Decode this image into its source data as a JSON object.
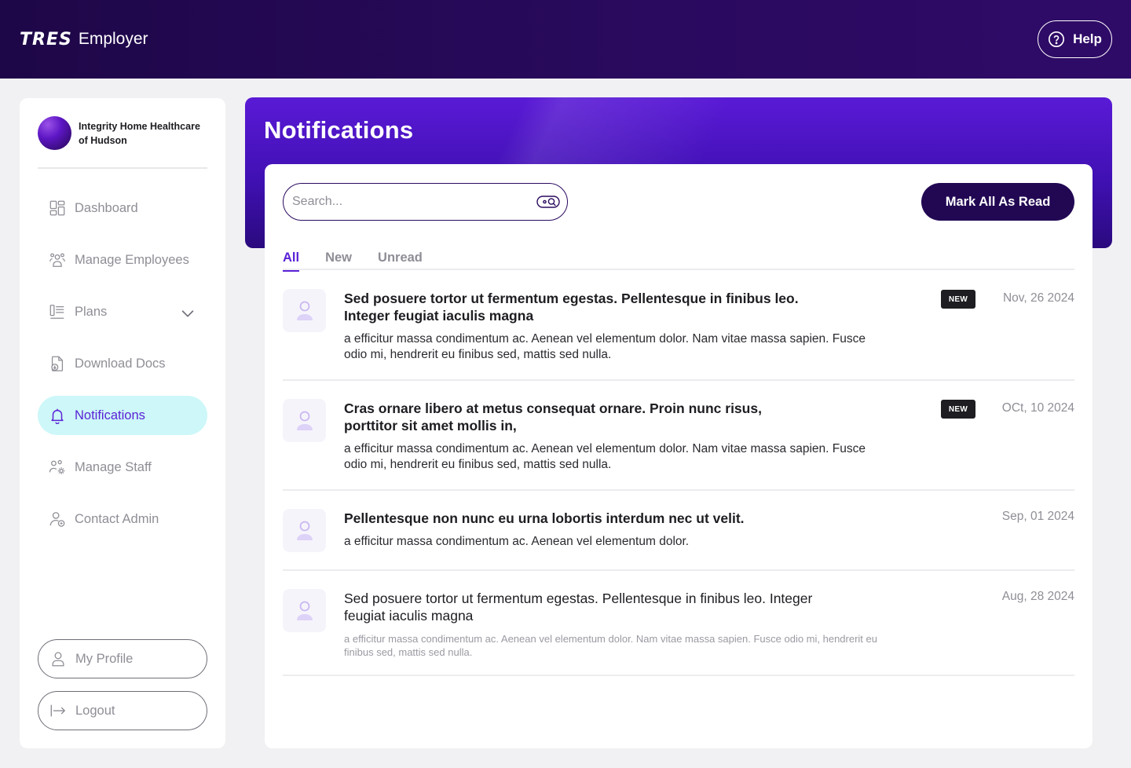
{
  "app": {
    "brand_logo": "TRES",
    "brand_name": "Employer",
    "help_label": "Help"
  },
  "sidebar": {
    "org_name": "Integrity Home Healthcare of Hudson",
    "items": [
      {
        "label": "Dashboard",
        "icon": "dashboard-icon"
      },
      {
        "label": "Manage Employees",
        "icon": "employees-icon"
      },
      {
        "label": "Plans",
        "icon": "plans-icon"
      },
      {
        "label": "Download Docs",
        "icon": "download-doc-icon"
      },
      {
        "label": "Notifications",
        "icon": "bell-icon",
        "active": true
      },
      {
        "label": "Manage Staff",
        "icon": "staff-gear-icon"
      },
      {
        "label": "Contact Admin",
        "icon": "contact-admin-icon"
      }
    ],
    "profile_label": "My Profile",
    "logout_label": "Logout"
  },
  "main": {
    "title": "Notifications",
    "search_placeholder": "Search...",
    "mark_all_label": "Mark All As Read",
    "tabs": [
      {
        "label": "All",
        "active": true
      },
      {
        "label": "New"
      },
      {
        "label": "Unread"
      }
    ],
    "notifications": [
      {
        "title": "Sed posuere tortor ut fermentum egestas. Pellentesque in finibus leo. Integer feugiat iaculis magna",
        "body": "a efficitur massa condimentum ac. Aenean vel elementum dolor. Nam vitae massa sapien. Fusce odio mi, hendrerit eu finibus sed, mattis sed nulla.",
        "badge": "NEW",
        "date": "Nov, 26 2024"
      },
      {
        "title": "Cras ornare libero at metus consequat ornare. Proin nunc risus, porttitor sit amet mollis in,",
        "body": "a efficitur massa condimentum ac. Aenean vel elementum dolor. Nam vitae massa sapien. Fusce odio mi, hendrerit eu finibus sed, mattis sed nulla.",
        "badge": "NEW",
        "date": "OCt, 10 2024"
      },
      {
        "title": "Pellentesque non nunc eu urna lobortis interdum nec ut velit.",
        "body": "a efficitur massa condimentum ac. Aenean vel elementum dolor.",
        "date": "Sep, 01 2024"
      },
      {
        "title": "Sed posuere tortor ut fermentum egestas. Pellentesque in finibus leo. Integer feugiat iaculis magna",
        "body": "a efficitur massa condimentum ac. Aenean vel elementum dolor. Nam vitae massa sapien. Fusce odio mi, hendrerit eu finibus sed, mattis sed nulla.",
        "date": "Aug, 28 2024",
        "read": true
      }
    ]
  },
  "colors": {
    "topbar": "#220853",
    "accent": "#5a22d6",
    "active_nav_bg": "#cdf7f8",
    "badge_bg": "#1d1d22"
  }
}
